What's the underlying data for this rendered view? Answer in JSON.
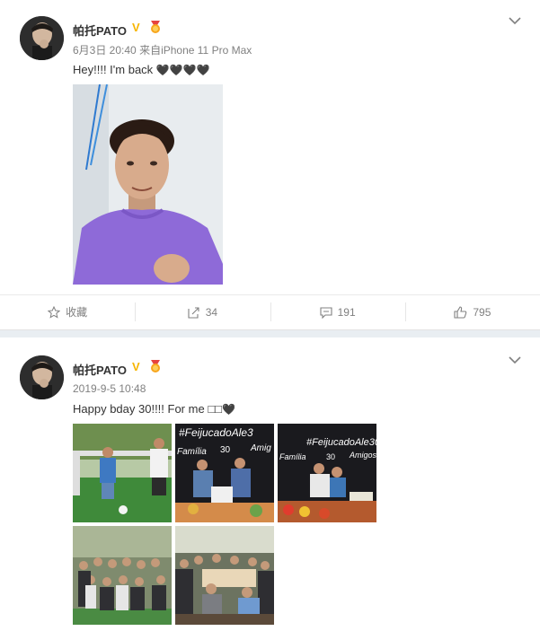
{
  "posts": [
    {
      "user": {
        "name": "帕托PATO",
        "verified_mark": "V"
      },
      "meta": {
        "date": "6月3日 20:40",
        "source_prefix": "来自",
        "source": "iPhone 11 Pro Max"
      },
      "text": {
        "body": "Hey!!!! I'm back",
        "hearts": "🖤🖤🖤🖤"
      },
      "actions": [
        {
          "label": "收藏",
          "icon": "star-icon"
        },
        {
          "label": "34",
          "icon": "share-icon"
        },
        {
          "label": "191",
          "icon": "comment-icon"
        },
        {
          "label": "795",
          "icon": "like-icon"
        }
      ]
    },
    {
      "user": {
        "name": "帕托PATO",
        "verified_mark": "V"
      },
      "meta": {
        "date": "2019-9-5 10:48"
      },
      "text": {
        "body": "Happy bday 30!!!! For me",
        "emoji": "□□",
        "heart": "🖤"
      },
      "photo_texts": {
        "p2_hashtag": "#FeijucadoAle3",
        "p2_left": "Família",
        "p2_right": "Amig",
        "p2_num": "30",
        "p3_hashtag": "#FeijucadoAle30",
        "p3_left": "Família",
        "p3_num": "30",
        "p3_right": "Amigos"
      }
    }
  ],
  "colors": {
    "verified": "#f7b500",
    "accent_orange": "#ff8200",
    "link": "#333333"
  }
}
